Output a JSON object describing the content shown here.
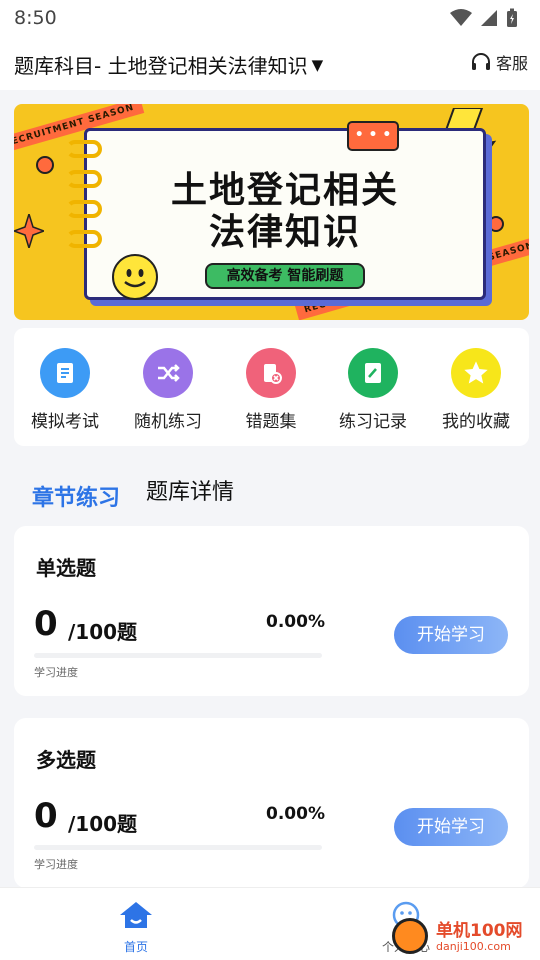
{
  "status_bar": {
    "time": "8:50"
  },
  "header": {
    "subject_label": "题库科目- 土地登记相关法律知识",
    "dropdown_glyph": "▼",
    "service_label": "客服"
  },
  "banner": {
    "title_line1": "土地登记相关",
    "title_line2": "法律知识",
    "tagline": "高效备考  智能刷题",
    "tape_text": "RECRUITMENT SEASON",
    "bubble_text": "• • •"
  },
  "shortcuts": [
    {
      "label": "模拟考试",
      "icon": "exam-doc-icon",
      "color": "#3d9bf5"
    },
    {
      "label": "随机练习",
      "icon": "shuffle-icon",
      "color": "#9a73e8"
    },
    {
      "label": "错题集",
      "icon": "wrong-set-icon",
      "color": "#f0627a"
    },
    {
      "label": "练习记录",
      "icon": "record-icon",
      "color": "#1fb35f"
    },
    {
      "label": "我的收藏",
      "icon": "star-icon",
      "color": "#f7d21a"
    }
  ],
  "tabs": {
    "active": "章节练习",
    "inactive": "题库详情"
  },
  "cards": [
    {
      "title": "单选题",
      "count": "0",
      "total": "/100题",
      "percent": "0.00%",
      "progress": 0,
      "progress_label": "学习进度",
      "button": "开始学习"
    },
    {
      "title": "多选题",
      "count": "0",
      "total": "/100题",
      "percent": "0.00%",
      "progress": 0,
      "progress_label": "学习进度",
      "button": "开始学习"
    }
  ],
  "bottom_nav": {
    "home": "首页",
    "me": "个人中心"
  },
  "watermark": {
    "line1": "单机100网",
    "line2": "danji100.com"
  }
}
